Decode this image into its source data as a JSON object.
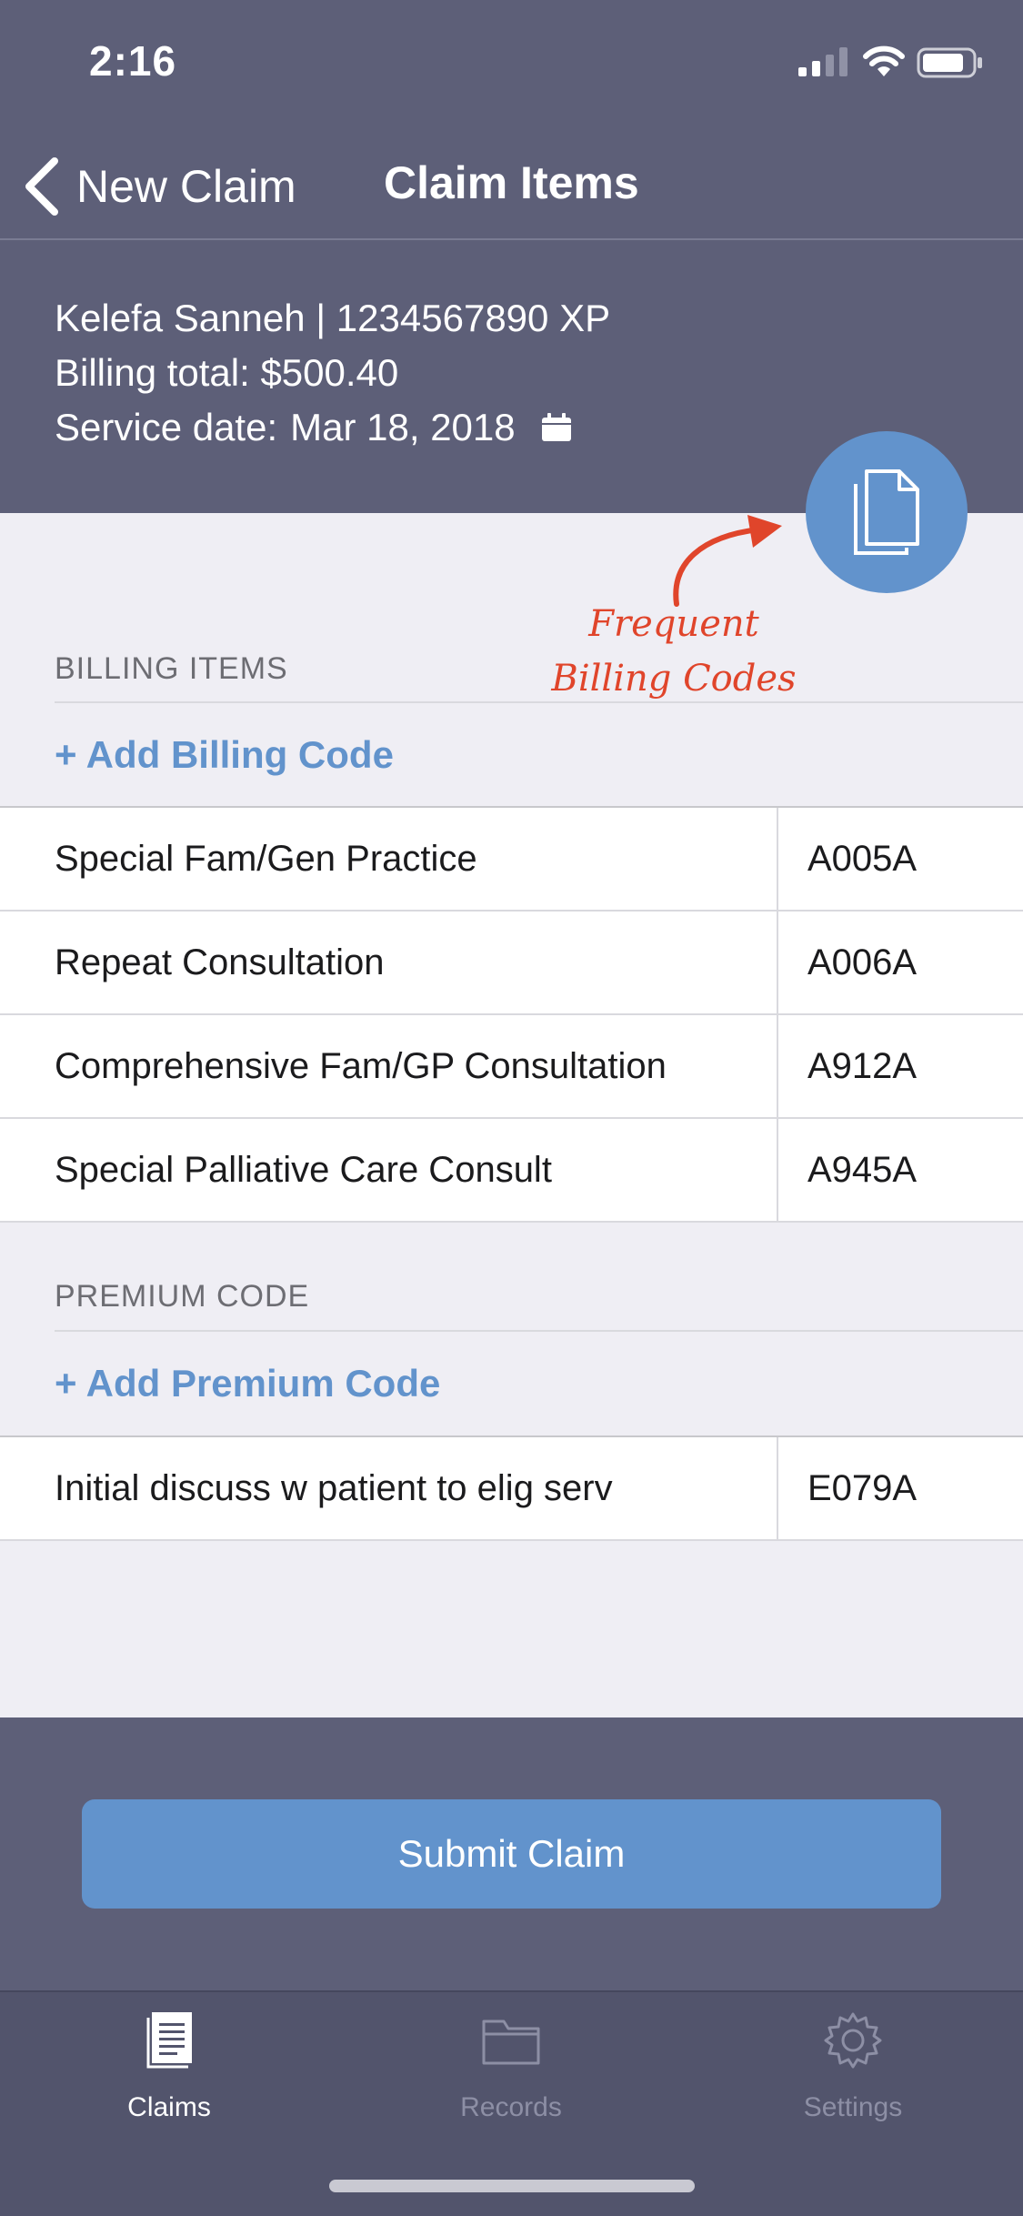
{
  "status_bar": {
    "time": "2:16"
  },
  "nav": {
    "back_label": "New Claim",
    "title": "Claim Items"
  },
  "patient": {
    "line": "Kelefa Sanneh | 1234567890 XP",
    "billing_total": "Billing total: $500.40",
    "service_date_label": "Service date:",
    "service_date": "Mar 18, 2018"
  },
  "annotation": {
    "line1": "Frequent",
    "line2": "Billing Codes"
  },
  "billing": {
    "header": "BILLING ITEMS",
    "add_label": "+ Add Billing Code",
    "items": [
      {
        "name": "Special Fam/Gen Practice",
        "code": "A005A"
      },
      {
        "name": "Repeat Consultation",
        "code": "A006A"
      },
      {
        "name": "Comprehensive Fam/GP Consultation",
        "code": "A912A"
      },
      {
        "name": "Special Palliative Care Consult",
        "code": "A945A"
      }
    ]
  },
  "premium": {
    "header": "PREMIUM CODE",
    "add_label": "+ Add Premium Code",
    "items": [
      {
        "name": "Initial discuss w patient to elig serv",
        "code": "E079A"
      }
    ]
  },
  "submit_label": "Submit Claim",
  "tabs": [
    {
      "label": "Claims",
      "icon": "document-list-icon",
      "active": true
    },
    {
      "label": "Records",
      "icon": "folder-icon",
      "active": false
    },
    {
      "label": "Settings",
      "icon": "gear-icon",
      "active": false
    }
  ],
  "colors": {
    "header_bg": "#5d5f78",
    "accent": "#6293cc",
    "annotation": "#e0452b",
    "page_bg": "#efeef4"
  }
}
